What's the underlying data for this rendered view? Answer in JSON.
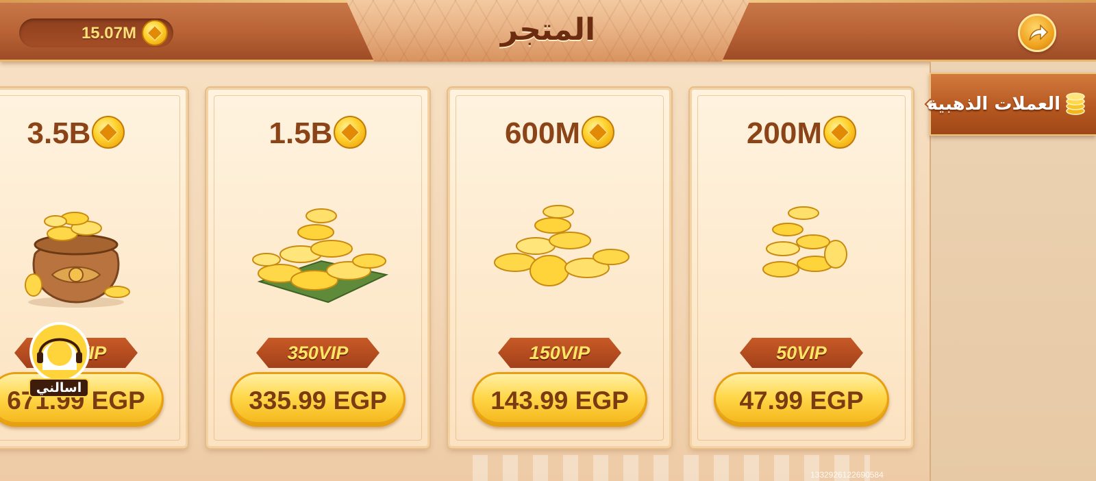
{
  "header": {
    "title": "المتجر",
    "balance": "15.07M",
    "balance_icon": "gold-coin-icon",
    "share_icon": "share-arrow-icon"
  },
  "sidebar": {
    "tabs": [
      {
        "label": "العملات الذهبية",
        "icon": "coin-stack-icon",
        "selected": true
      }
    ]
  },
  "packages": [
    {
      "amount": "3.5B",
      "vip": "650VIP",
      "price": "671.99 EGP",
      "art": "coin-pot-icon"
    },
    {
      "amount": "1.5B",
      "vip": "350VIP",
      "price": "335.99 EGP",
      "art": "coin-pile-large-icon"
    },
    {
      "amount": "600M",
      "vip": "150VIP",
      "price": "143.99 EGP",
      "art": "coin-pile-medium-icon"
    },
    {
      "amount": "200M",
      "vip": "50VIP",
      "price": "47.99 EGP",
      "art": "coin-stack-small-icon"
    }
  ],
  "support": {
    "label": "اسالني",
    "icon": "customer-support-avatar-icon"
  },
  "footer": {
    "device_id": "1332926122690584"
  },
  "colors": {
    "header": "#b86236",
    "title": "#6b2c10",
    "price_button": "#ffd74a",
    "vip_ribbon": "#a2401a",
    "card_bg": "#fdebd0"
  }
}
